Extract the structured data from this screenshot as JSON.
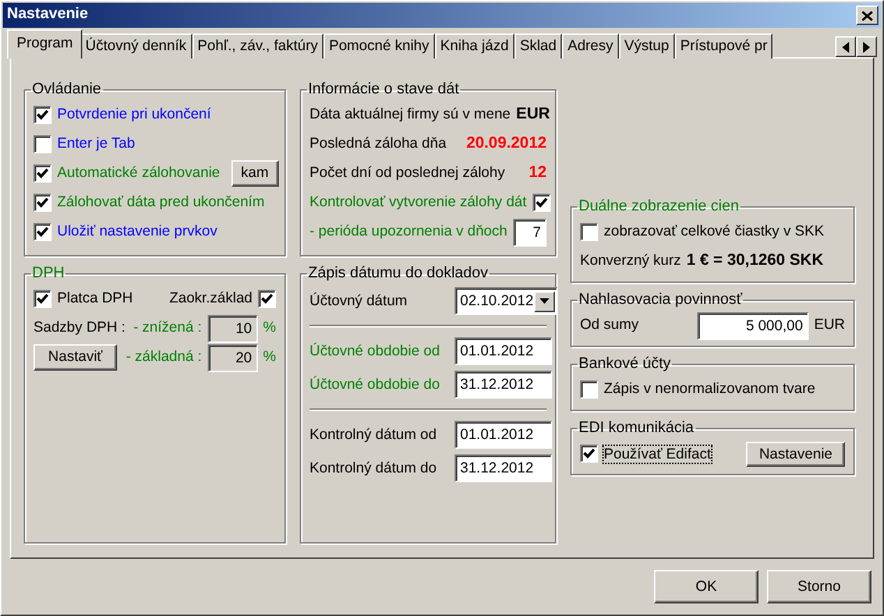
{
  "window": {
    "title": "Nastavenie"
  },
  "tabs": [
    {
      "label": "Program",
      "selected": true
    },
    {
      "label": "Účtovný denník",
      "selected": false
    },
    {
      "label": "Pohľ., záv., faktúry",
      "selected": false
    },
    {
      "label": "Pomocné knihy",
      "selected": false
    },
    {
      "label": "Kniha jázd",
      "selected": false
    },
    {
      "label": "Sklad",
      "selected": false
    },
    {
      "label": "Adresy",
      "selected": false
    },
    {
      "label": "Výstup",
      "selected": false
    },
    {
      "label": "Prístupové pr",
      "selected": false
    }
  ],
  "ovladanie": {
    "title": "Ovládanie",
    "items": [
      {
        "label": "Potvrdenie pri ukončení",
        "checked": true,
        "color": "#0000ff"
      },
      {
        "label": "Enter je Tab",
        "checked": false,
        "color": "#0000ff"
      },
      {
        "label": "Automatické zálohovanie",
        "checked": true,
        "color": "#008000",
        "button": "kam"
      },
      {
        "label": "Zálohovať dáta pred ukončením",
        "checked": true,
        "color": "#008000"
      },
      {
        "label": "Uložiť nastavenie prvkov",
        "checked": true,
        "color": "#0000ff"
      }
    ]
  },
  "dph": {
    "title": "DPH",
    "platca": {
      "label": "Platca DPH",
      "checked": true
    },
    "zaokr": {
      "label": "Zaokr.základ",
      "checked": true
    },
    "sadzby_label": "Sadzby DPH :",
    "button": "Nastaviť",
    "rates": [
      {
        "label": "- znížená :",
        "value": "10",
        "unit": "%",
        "disabled": true
      },
      {
        "label": "- základná :",
        "value": "20",
        "unit": "%",
        "disabled": true
      }
    ]
  },
  "informacie": {
    "title": "Informácie o stave dát",
    "rows": [
      {
        "kind": "value",
        "label": "Dáta aktuálnej firmy sú v mene",
        "value": "EUR",
        "color": "#000000"
      },
      {
        "kind": "value",
        "label": "Posledná záloha dňa",
        "value": "20.09.2012",
        "color": "#ff0000"
      },
      {
        "kind": "value",
        "label": "Počet dní od poslednej zálohy",
        "value": "12",
        "color": "#ff0000"
      },
      {
        "kind": "check",
        "label": "Kontrolovať vytvorenie zálohy dát",
        "checked": true,
        "color": "#008000"
      },
      {
        "kind": "input",
        "label": " - perióda upozornenia v dňoch",
        "value": "7",
        "color": "#008000"
      }
    ]
  },
  "zapis": {
    "title": "Zápis dátumu do dokladov",
    "sections": [
      [
        {
          "kind": "dropdown",
          "label": "Účtovný dátum",
          "value": "02.10.2012",
          "color": "#000000"
        }
      ],
      [
        {
          "kind": "input",
          "label": "Účtovné obdobie od",
          "value": "01.01.2012",
          "color": "#008000"
        },
        {
          "kind": "input",
          "label": "Účtovné obdobie do",
          "value": "31.12.2012",
          "color": "#008000"
        }
      ],
      [
        {
          "kind": "input",
          "label": "Kontrolný dátum od",
          "value": "01.01.2012",
          "color": "#000000"
        },
        {
          "kind": "input",
          "label": "Kontrolný dátum do",
          "value": "31.12.2012",
          "color": "#000000"
        }
      ]
    ]
  },
  "dualne": {
    "title": "Duálne zobrazenie cien",
    "checkbox": {
      "label": "zobrazovať celkové čiastky v SKK",
      "checked": false
    },
    "kurz_label": "Konverzný kurz",
    "kurz_value": "1 € = 30,1260 SKK"
  },
  "nahlasovacia": {
    "title": "Nahlasovacia povinnosť",
    "label": "Od sumy",
    "value": "5 000,00",
    "unit": "EUR"
  },
  "bankove": {
    "title": "Bankové účty",
    "checkbox": {
      "label": "Zápis v nenormalizovanom tvare",
      "checked": false
    }
  },
  "edi": {
    "title": "EDI komunikácia",
    "checkbox": {
      "label": "Používať Edifact",
      "checked": true
    },
    "button": "Nastavenie"
  },
  "buttons": [
    "OK",
    "Storno"
  ]
}
